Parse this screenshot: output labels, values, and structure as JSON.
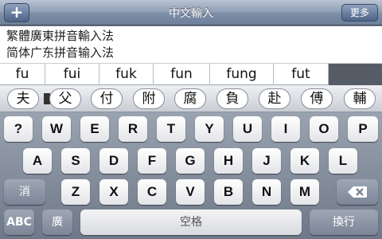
{
  "titlebar": {
    "add_label": "+",
    "title": "中文輸入",
    "more_label": "更多"
  },
  "ime_list": [
    "繁體廣東拼音輸入法",
    "简体广东拼音输入法"
  ],
  "pinyin_candidates": [
    "fu",
    "fui",
    "fuk",
    "fun",
    "fung",
    "fut"
  ],
  "char_candidates": [
    "夫",
    "父",
    "付",
    "附",
    "腐",
    "負",
    "赴",
    "傅",
    "輔"
  ],
  "keyboard": {
    "row1": [
      "?",
      "W",
      "E",
      "R",
      "T",
      "Y",
      "U",
      "I",
      "O",
      "P"
    ],
    "row2": [
      "A",
      "S",
      "D",
      "F",
      "G",
      "H",
      "J",
      "K",
      "L"
    ],
    "row3": [
      "Z",
      "X",
      "C",
      "V",
      "B",
      "N",
      "M"
    ],
    "shift_label": "消",
    "abc_label": "ABC",
    "lang_label": "廣",
    "space_label": "空格",
    "return_label": "換行",
    "delete_icon": "backspace-icon"
  }
}
